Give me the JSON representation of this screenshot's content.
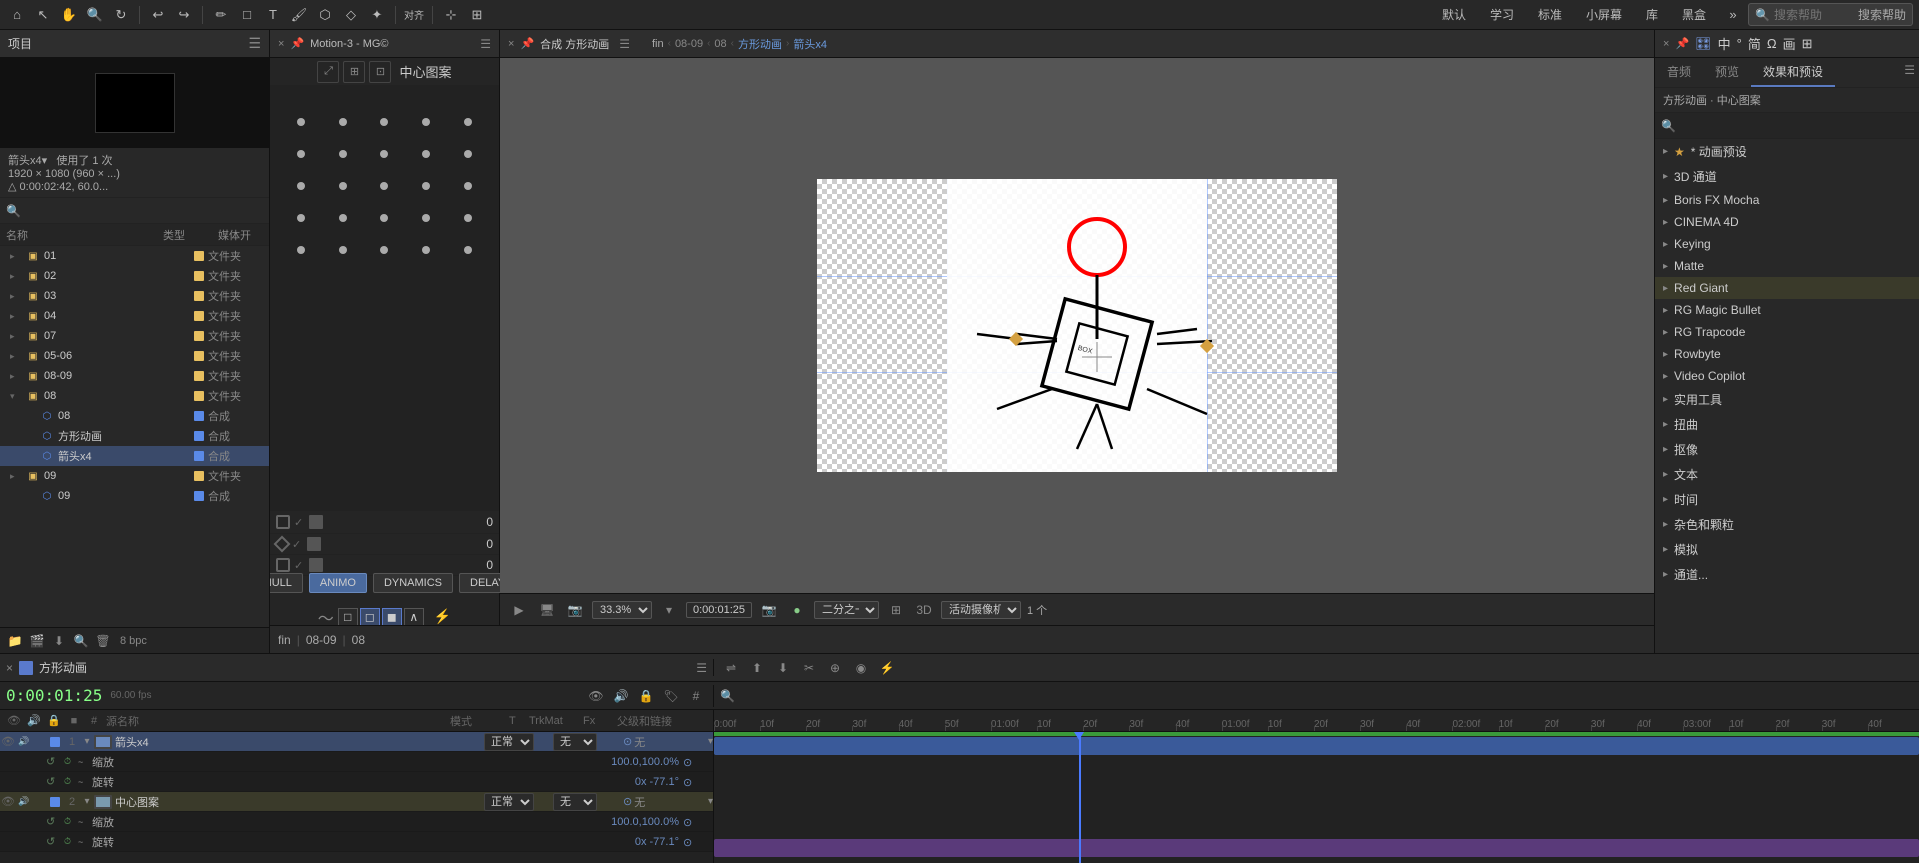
{
  "toolbar": {
    "nav_items": [
      "默认",
      "学习",
      "标准",
      "小屏幕",
      "库",
      "黑盒"
    ],
    "search_placeholder": "搜索帮助",
    "search_icon": "🔍"
  },
  "project_panel": {
    "title": "项目",
    "current_item": "箭头x4",
    "current_item_detail": "使用了 1 次",
    "current_item_info": "1920 × 1080 (960 × ...)",
    "current_item_time": "△ 0:00:02:42, 60.0...",
    "search_placeholder": "",
    "columns": [
      "名称",
      "类型",
      "媒体开"
    ],
    "items": [
      {
        "id": "01",
        "name": "01",
        "type": "文件夹",
        "color": "#e8c060",
        "level": 0
      },
      {
        "id": "02",
        "name": "02",
        "type": "文件夹",
        "color": "#e8c060",
        "level": 0
      },
      {
        "id": "03",
        "name": "03",
        "type": "文件夹",
        "color": "#e8c060",
        "level": 0
      },
      {
        "id": "04",
        "name": "04",
        "type": "文件夹",
        "color": "#e8c060",
        "level": 0
      },
      {
        "id": "07",
        "name": "07",
        "type": "文件夹",
        "color": "#e8c060",
        "level": 0
      },
      {
        "id": "05-06",
        "name": "05-06",
        "type": "文件夹",
        "color": "#e8c060",
        "level": 0
      },
      {
        "id": "08-09",
        "name": "08-09",
        "type": "文件夹",
        "color": "#e8c060",
        "level": 0
      },
      {
        "id": "08-parent",
        "name": "08",
        "type": "文件夹",
        "color": "#e8c060",
        "level": 0,
        "expanded": true
      },
      {
        "id": "08-child",
        "name": "08",
        "type": "合成",
        "color": "#5a8ae8",
        "level": 1
      },
      {
        "id": "square-anim",
        "name": "方形动画",
        "type": "合成",
        "color": "#5a8ae8",
        "level": 1
      },
      {
        "id": "arrow-x4",
        "name": "箭头x4",
        "type": "合成",
        "color": "#5a8ae8",
        "level": 1,
        "selected": true
      },
      {
        "id": "09",
        "name": "09",
        "type": "文件夹",
        "color": "#e8c060",
        "level": 0
      },
      {
        "id": "09-child",
        "name": "09",
        "type": "合成",
        "color": "#5a8ae8",
        "level": 1
      }
    ]
  },
  "motion_panel": {
    "title": "Motion-3 - MG©",
    "section_title": "中心图案",
    "dots": 25,
    "rows": [
      {
        "shape": "square",
        "value": "0"
      },
      {
        "shape": "diamond",
        "value": "0"
      },
      {
        "shape": "square",
        "value": "0"
      }
    ],
    "buttons": [
      "NULL",
      "ANIMO",
      "DYNAMICS",
      "DELAY"
    ]
  },
  "comp_panel": {
    "tab_label": "合成 方形动画",
    "breadcrumb": [
      "fin",
      "08-09",
      "08",
      "方形动画",
      "箭头x4"
    ],
    "sub_title": "方形动画 · 中心图案",
    "zoom": "33.3%",
    "timecode": "0:00:01:25",
    "camera": "活动摄像机",
    "channels": "1 个"
  },
  "effects_panel": {
    "tabs": [
      "音频",
      "预览",
      "效果和预设"
    ],
    "active_tab": "效果和预设",
    "search_placeholder": "",
    "info_text": "方形动画 · 中心图案",
    "categories": [
      {
        "name": "* 动画预设",
        "star": true
      },
      {
        "name": "3D 通道"
      },
      {
        "name": "Boris FX Mocha"
      },
      {
        "name": "CINEMA 4D"
      },
      {
        "name": "Keying"
      },
      {
        "name": "Matte"
      },
      {
        "name": "Red Giant",
        "highlighted": true
      },
      {
        "name": "RG Magic Bullet"
      },
      {
        "name": "RG Trapcode"
      },
      {
        "name": "Rowbyte"
      },
      {
        "name": "Video Copilot"
      },
      {
        "name": "实用工具"
      },
      {
        "name": "扭曲"
      },
      {
        "name": "抠像"
      },
      {
        "name": "文本"
      },
      {
        "name": "时间"
      },
      {
        "name": "杂色和颗粒"
      },
      {
        "name": "模拟"
      },
      {
        "name": "通道..."
      }
    ]
  },
  "timeline": {
    "tab_label": "方形动画",
    "timecode": "0:00:01:25",
    "fps": "60.00 fps",
    "columns": [
      "源名称",
      "模式",
      "T",
      "TrkMat",
      "父级和链接"
    ],
    "layers": [
      {
        "num": "1",
        "name": "箭头x4",
        "mode": "正常",
        "parent": "无",
        "color": "#5a8ae8",
        "selected": true,
        "sub_rows": [
          {
            "icon": "↺",
            "label": "缩放",
            "value": "100.0,100.0%"
          },
          {
            "icon": "↺",
            "label": "旋转",
            "value": "0x -77.1°"
          }
        ]
      },
      {
        "num": "2",
        "name": "中心图案",
        "mode": "正常",
        "parent": "无",
        "color": "#5a8ae8",
        "highlighted": true,
        "sub_rows": [
          {
            "icon": "↺",
            "label": "缩放",
            "value": "100.0,100.0%"
          },
          {
            "icon": "↺",
            "label": "旋转",
            "value": "0x -77.1°"
          }
        ]
      }
    ],
    "ruler_labels": [
      "0:00f",
      "10f",
      "20f",
      "30f",
      "40f",
      "50f",
      "01:00f",
      "10f",
      "20f",
      "30f",
      "40f",
      "01:00f",
      "10f",
      "20f",
      "30f",
      "40f",
      "02:00f",
      "10f",
      "20f",
      "30f",
      "40f",
      "03:00f",
      "10f",
      "20f",
      "30f",
      "40f"
    ]
  },
  "status_bar": {
    "fin_label": "fin",
    "time_08_09": "08-09",
    "time_08": "08"
  }
}
